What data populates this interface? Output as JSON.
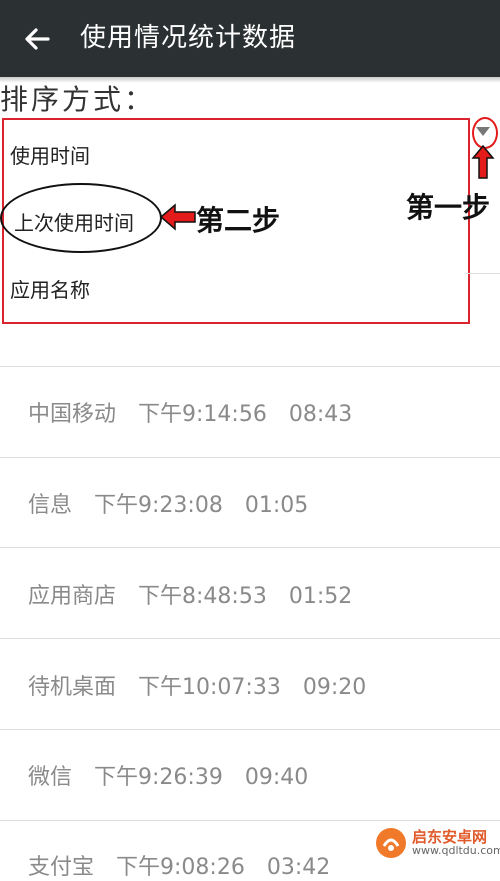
{
  "header": {
    "title": "使用情况统计数据",
    "back_icon": "back-arrow-icon"
  },
  "sort": {
    "label": "排序方式：",
    "options": [
      "使用时间",
      "上次使用时间",
      "应用名称"
    ]
  },
  "annotations": {
    "step1": "第一步",
    "step2": "第二步",
    "color": "#e31b1b"
  },
  "rows": [
    {
      "app": "中国移动",
      "last_used": "下午9:14:56",
      "duration": "08:43"
    },
    {
      "app": "信息",
      "last_used": "下午9:23:08",
      "duration": "01:05"
    },
    {
      "app": "应用商店",
      "last_used": "下午8:48:53",
      "duration": "01:52"
    },
    {
      "app": "待机桌面",
      "last_used": "下午10:07:33",
      "duration": "09:20"
    },
    {
      "app": "微信",
      "last_used": "下午9:26:39",
      "duration": "09:40"
    },
    {
      "app": "支付宝",
      "last_used": "下午9:08:26",
      "duration": "03:42"
    }
  ],
  "watermark": {
    "name": "启东安卓网",
    "url": "www.qdltdu.com"
  },
  "colors": {
    "appbar": "#2b3033",
    "row_text": "#8a8a8a"
  }
}
